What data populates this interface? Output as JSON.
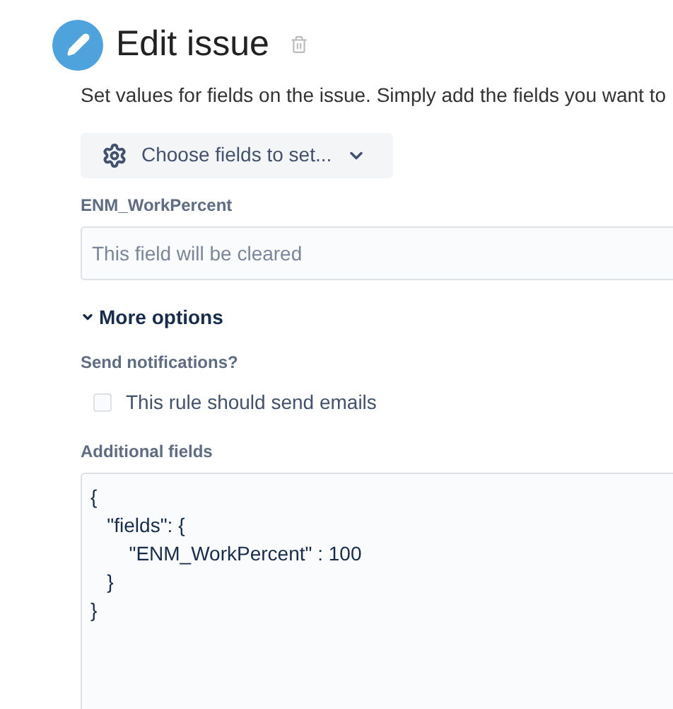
{
  "header": {
    "title": "Edit issue"
  },
  "description": "Set values for fields on the issue. Simply add the fields you want to",
  "choose_fields_button": {
    "label": "Choose fields to set..."
  },
  "fields": [
    {
      "label": "ENM_WorkPercent",
      "placeholder": "This field will be cleared"
    }
  ],
  "more_options": {
    "label": "More options",
    "expanded": true
  },
  "notifications": {
    "label": "Send notifications?",
    "checkbox": {
      "label": "This rule should send emails",
      "checked": false
    }
  },
  "additional_fields": {
    "label": "Additional fields",
    "value": "{\n   \"fields\": {\n       \"ENM_WorkPercent\" : 100\n   }\n}"
  }
}
